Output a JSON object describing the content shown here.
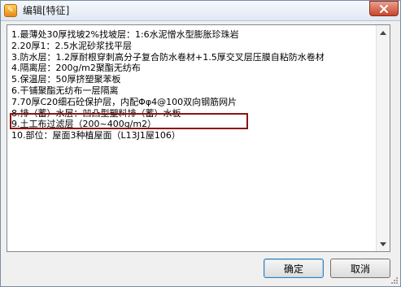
{
  "window": {
    "title": "编辑[特征]",
    "app_icon": "edit-app-icon",
    "close_icon": "close-icon"
  },
  "editor": {
    "lines": [
      "1.最薄处30厚找坡2%找坡层：1:6水泥憎水型膨胀珍珠岩",
      "2.20厚1：2.5水泥砂浆找平层",
      "3.防水层：1.2厚耐根穿刺高分子复合防水卷材+1.5厚交叉层压膜自粘防水卷材",
      "4.隔离层：200g/m2聚酯无纺布",
      "5.保温层：50厚挤塑聚苯板",
      "6.干铺聚酯无纺布一层隔离",
      "7.70厚C20细石砼保护层，内配Φφ4@100双向钢筋网片",
      "8.排（蓄）水层：凹凸型塑料排（蓄）水板",
      "9.土工布过滤层（200~400g/m2）",
      "10.部位：屋面3种植屋面（L13J1屋106）"
    ],
    "highlighted_line_index": 6,
    "highlight_color": "#8b1414"
  },
  "buttons": {
    "ok_label": "确定",
    "cancel_label": "取消"
  }
}
